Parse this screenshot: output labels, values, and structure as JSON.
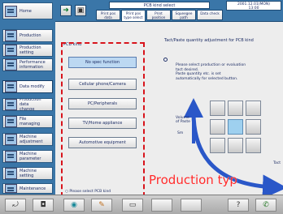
{
  "sidebar": {
    "items": [
      {
        "label": "Home",
        "icon": "home-icon"
      },
      {
        "label": "Production",
        "icon": "production-icon"
      },
      {
        "label": "Production\nsetting",
        "icon": "setting-icon"
      },
      {
        "label": "Performance\ninformation",
        "icon": "chart-icon"
      },
      {
        "label": "Data modify",
        "icon": "edit-icon"
      },
      {
        "label": "Production\ndata\nchange",
        "icon": "data-change-icon"
      },
      {
        "label": "File\nmanaging",
        "icon": "folder-icon"
      },
      {
        "label": "Machine\nadjustment",
        "icon": "wrench-icon"
      },
      {
        "label": "Machine\nparameter",
        "icon": "parameter-icon"
      },
      {
        "label": "Machine\nsetting",
        "icon": "machine-icon"
      },
      {
        "label": "Maintenance",
        "icon": "maintenance-icon"
      }
    ]
  },
  "header": {
    "title": "PCB kind select",
    "datetime": "2001.12.01(MON)\n13:00",
    "tabs": [
      {
        "label": "Print pos\ndata"
      },
      {
        "label": "Print pos\ntype select"
      },
      {
        "label": "Print\nposition"
      },
      {
        "label": "Squeegee\npath"
      },
      {
        "label": "Data check"
      }
    ]
  },
  "left_panel": {
    "title": "PCB kind",
    "types": [
      "No spec function",
      "Cellular phone/Camera",
      "PC/Peripherals",
      "TV/Home appliance",
      "Automotive equipment"
    ],
    "hint": "Please select PCB kind"
  },
  "right_panel": {
    "title": "Tact/Paste quantity adjustment for PCB kind",
    "message": "Please select production or evaluation\ntact desired.\nPaste quantity etc. is set\nautomatically for selected button.",
    "y_axis": "Volume\nof Paste",
    "y_small": "Sm",
    "x_axis": "Tact"
  },
  "overlay_text": "Production typ",
  "colors": {
    "sidebar_bg": "#3a76a8",
    "dashed_box": "#d8141c",
    "arrow": "#2a57c8",
    "overlay": "#ff2a2a"
  }
}
